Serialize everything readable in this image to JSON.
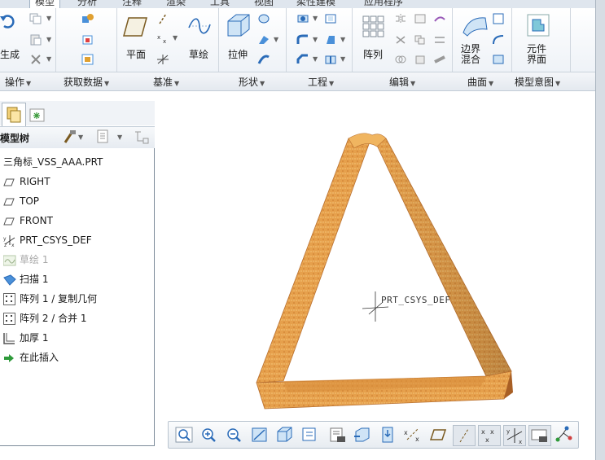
{
  "tabs": [
    "模型",
    "分析",
    "注释",
    "渲染",
    "工具",
    "视图",
    "柔性建模",
    "应用程序"
  ],
  "ribbon": {
    "operations": {
      "regenerate_label": "生成",
      "group_label": "操作"
    },
    "get_data": {
      "group_label": "获取数据"
    },
    "datum": {
      "plane_label": "平面",
      "sketch_label": "草绘",
      "group_label": "基准"
    },
    "shapes": {
      "extrude_label": "拉伸",
      "group_label": "形状"
    },
    "engineering": {
      "group_label": "工程"
    },
    "editing": {
      "pattern_label": "阵列",
      "group_label": "编辑"
    },
    "surfaces": {
      "boundary_blend_label": "边界\n混合",
      "group_label": "曲面"
    },
    "model_intent": {
      "component_interface_label": "元件\n界面",
      "group_label": "模型意图"
    }
  },
  "model_tree": {
    "header": "模型树",
    "items": [
      {
        "label": "三角标_VSS_AAA.PRT",
        "icon": "part-icon",
        "dim": false
      },
      {
        "label": "RIGHT",
        "icon": "datum-plane-icon",
        "dim": false
      },
      {
        "label": "TOP",
        "icon": "datum-plane-icon",
        "dim": false
      },
      {
        "label": "FRONT",
        "icon": "datum-plane-icon",
        "dim": false
      },
      {
        "label": "PRT_CSYS_DEF",
        "icon": "csys-icon",
        "dim": false
      },
      {
        "label": "草绘 1",
        "icon": "sketch-icon",
        "dim": true
      },
      {
        "label": "扫描 1",
        "icon": "sweep-icon",
        "dim": false
      },
      {
        "label": "阵列 1 / 复制几何",
        "icon": "pattern-icon",
        "dim": false
      },
      {
        "label": "阵列 2 / 合并 1",
        "icon": "pattern-icon",
        "dim": false
      },
      {
        "label": "加厚 1",
        "icon": "thicken-icon",
        "dim": false
      },
      {
        "label": "在此插入",
        "icon": "insert-here-icon",
        "dim": false
      }
    ]
  },
  "viewport": {
    "csys_label": "PRT_CSYS_DEF",
    "model_color": "#e49a45"
  },
  "colors": {
    "accent": "#2a6bb8",
    "ribbon_bg": "#eef2f7"
  }
}
